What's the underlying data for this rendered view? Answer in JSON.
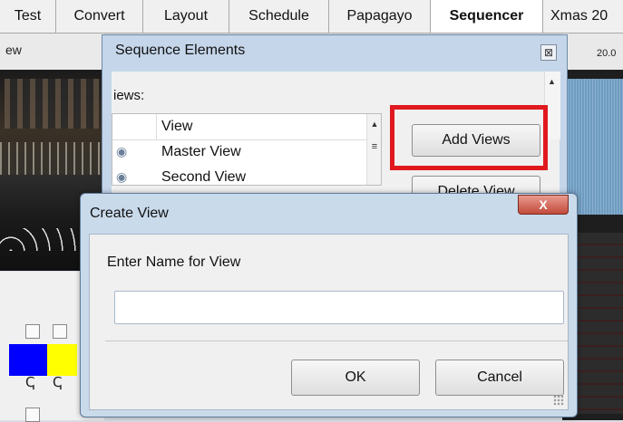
{
  "tabs": [
    {
      "label": "Test"
    },
    {
      "label": "Convert"
    },
    {
      "label": "Layout"
    },
    {
      "label": "Schedule"
    },
    {
      "label": "Papagayo"
    },
    {
      "label": "Sequencer"
    },
    {
      "label": "Xmas 20"
    }
  ],
  "active_tab": "Sequencer",
  "left_panel": {
    "header": "ew"
  },
  "timeline": {
    "ruler_text": "20.0"
  },
  "sequence_window": {
    "title": "Sequence Elements",
    "close_glyph": "⊠",
    "views_label": "iews:",
    "list": {
      "header": "View",
      "rows": [
        {
          "label": "Master View"
        },
        {
          "label": "Second View"
        }
      ]
    },
    "add_views_label": "Add Views",
    "delete_view_label": "Delete View"
  },
  "create_view_dialog": {
    "title": "Create View",
    "close_label": "X",
    "prompt": "Enter Name for View",
    "name_value": "",
    "ok_label": "OK",
    "cancel_label": "Cancel"
  },
  "colors": {
    "highlight_box": "#e0191f",
    "swatch_blue": "#0000ff",
    "swatch_yellow": "#ffff00"
  }
}
